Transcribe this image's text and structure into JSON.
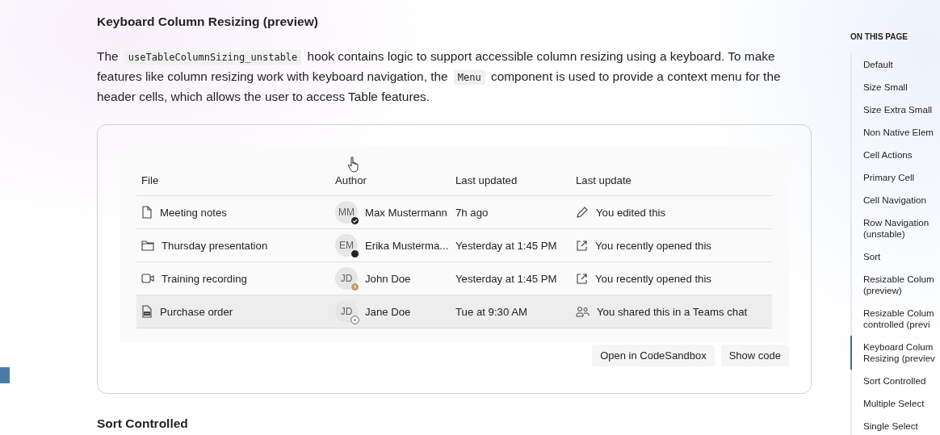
{
  "section": {
    "title": "Keyboard Column Resizing (preview)",
    "paragraph": [
      {
        "kind": "text",
        "text": "The "
      },
      {
        "kind": "code",
        "text": "useTableColumnSizing_unstable"
      },
      {
        "kind": "text",
        "text": " hook contains logic to support accessible column resizing using a keyboard. To make features like column resizing work with keyboard navigation, the "
      },
      {
        "kind": "code",
        "text": "Menu"
      },
      {
        "kind": "text",
        "text": " component is used to provide a context menu for the header cells, which allows the user to access Table features."
      }
    ]
  },
  "table": {
    "columns": [
      "File",
      "Author",
      "Last updated",
      "Last update"
    ],
    "rows": [
      {
        "file": {
          "kind": "document",
          "name": "Meeting notes"
        },
        "author": {
          "initials": "MM",
          "name": "Max Mustermann",
          "presence": {
            "kind": "available"
          }
        },
        "updated": "7h ago",
        "update": {
          "kind": "edit",
          "text": "You edited this"
        },
        "highlighted": false
      },
      {
        "file": {
          "kind": "folder",
          "name": "Thursday presentation"
        },
        "author": {
          "initials": "EM",
          "name": "Erika Musterma...",
          "presence": {
            "kind": "busy"
          }
        },
        "updated": "Yesterday at 1:45 PM",
        "update": {
          "kind": "open",
          "text": "You recently opened this"
        },
        "highlighted": false
      },
      {
        "file": {
          "kind": "video",
          "name": "Training recording"
        },
        "author": {
          "initials": "JD",
          "name": "John Doe",
          "presence": {
            "kind": "away"
          }
        },
        "updated": "Yesterday at 1:45 PM",
        "update": {
          "kind": "open",
          "text": "You recently opened this"
        },
        "highlighted": false
      },
      {
        "file": {
          "kind": "form",
          "name": "Purchase order"
        },
        "author": {
          "initials": "JD",
          "name": "Jane Doe",
          "presence": {
            "kind": "offline"
          }
        },
        "updated": "Tue at 9:30 AM",
        "update": {
          "kind": "share",
          "text": "You shared this in a Teams chat"
        },
        "highlighted": true
      }
    ]
  },
  "buttons": [
    "Open in CodeSandbox",
    "Show code"
  ],
  "next_heading": "Sort Controlled",
  "toc": {
    "title": "ON THIS PAGE",
    "items": [
      {
        "label": "Default",
        "selected": false
      },
      {
        "label": "Size Small",
        "selected": false
      },
      {
        "label": "Size Extra Small",
        "selected": false
      },
      {
        "label": "Non Native Elem",
        "selected": false
      },
      {
        "label": "Cell Actions",
        "selected": false
      },
      {
        "label": "Primary Cell",
        "selected": false
      },
      {
        "label": "Cell Navigation",
        "selected": false
      },
      {
        "label": "Row Navigation\n(unstable)",
        "selected": false
      },
      {
        "label": "Sort",
        "selected": false
      },
      {
        "label": "Resizable Colum\n(preview)",
        "selected": false
      },
      {
        "label": "Resizable Colum\ncontrolled (previ",
        "selected": false
      },
      {
        "label": "Keyboard Colum\nResizing (previev",
        "selected": true
      },
      {
        "label": "Sort Controlled",
        "selected": false
      },
      {
        "label": "Multiple Select",
        "selected": false
      },
      {
        "label": "Single Select",
        "selected": false
      }
    ]
  }
}
